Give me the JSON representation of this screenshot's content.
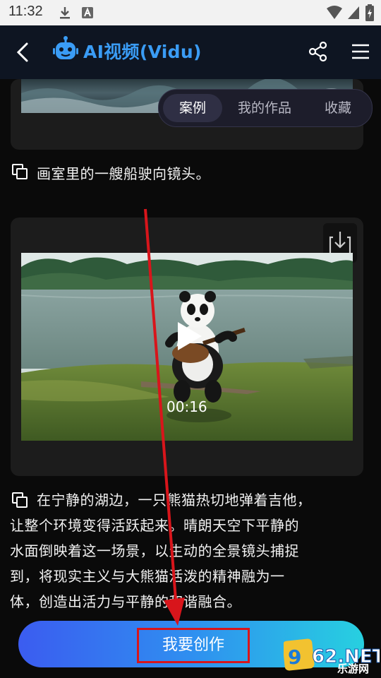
{
  "status_bar": {
    "time": "11:32"
  },
  "header": {
    "title": "AI视频(Vidu)"
  },
  "tabs": [
    {
      "label": "案例",
      "active": true
    },
    {
      "label": "我的作品",
      "active": false
    },
    {
      "label": "收藏",
      "active": false
    }
  ],
  "items": [
    {
      "caption": "画室里的一艘船驶向镜头。"
    },
    {
      "caption_lines": [
        "在宁静的湖边，一只熊猫热切地弹着吉他，",
        "让整个环境变得活跃起来。晴朗天空下平静的",
        "水面倒映着这一场景，以生动的全景镜头捕捉",
        "到，将现实主义与大熊猫活泼的精神融为一",
        "体，创造出活力与平静的和谐融合。"
      ],
      "video_duration": "00:16"
    }
  ],
  "footer": {
    "create_label": "我要创作"
  },
  "watermark": {
    "brand": "962.NET",
    "sub": "乐游网"
  },
  "colors": {
    "title": "#3a9cf5",
    "annotation": "#d8151b"
  }
}
